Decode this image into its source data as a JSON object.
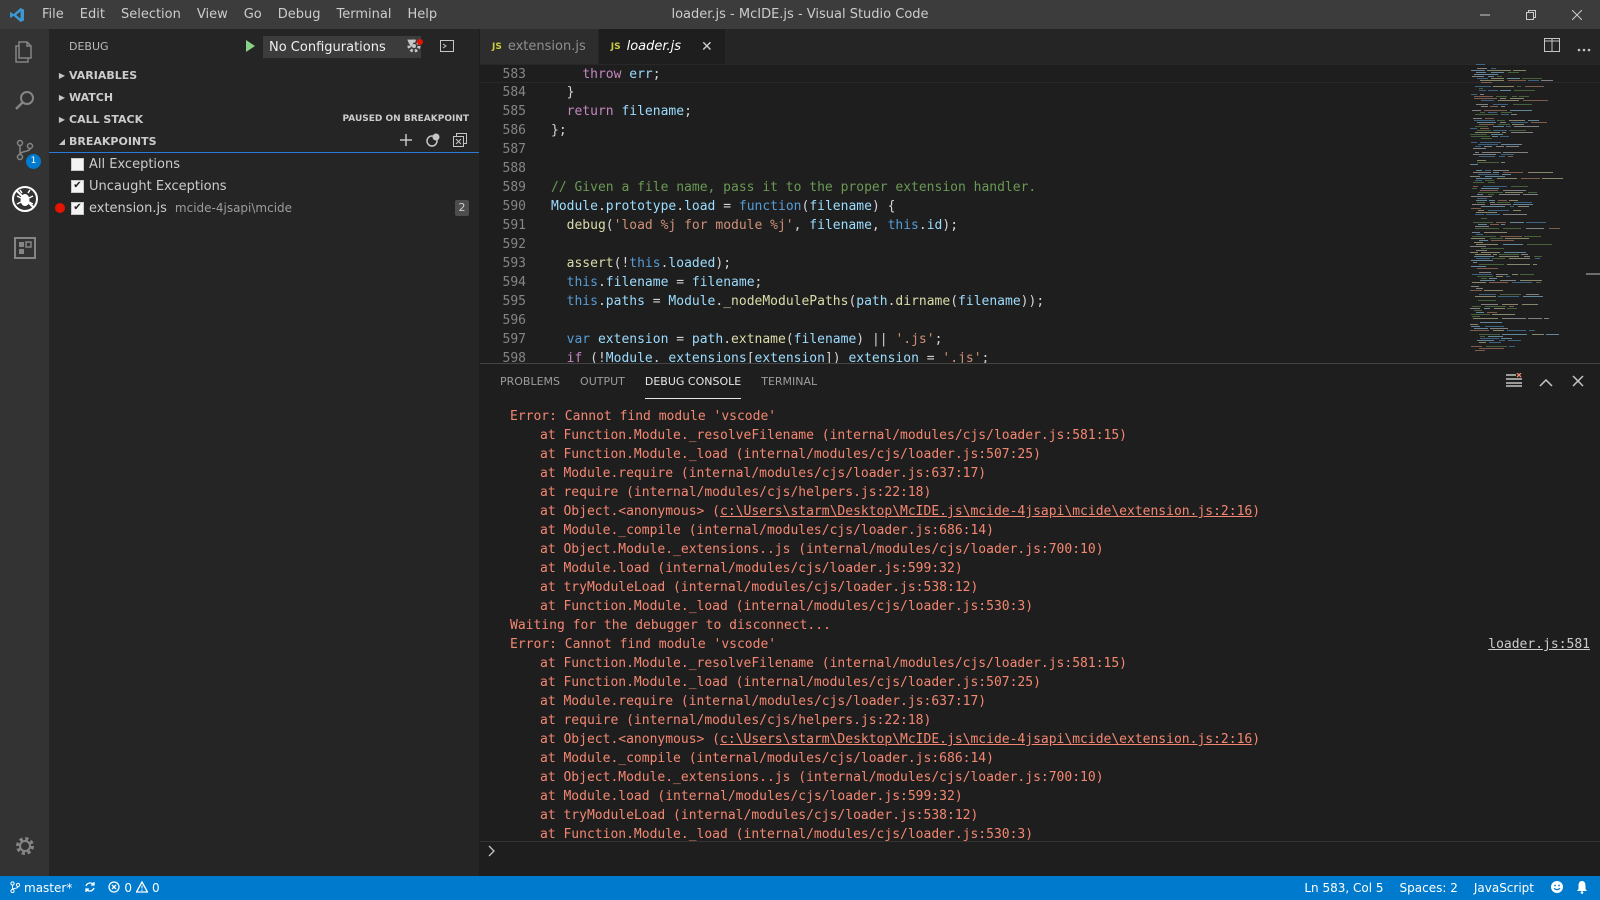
{
  "window": {
    "title": "loader.js - McIDE.js - Visual Studio Code",
    "menu": [
      "File",
      "Edit",
      "Selection",
      "View",
      "Go",
      "Debug",
      "Terminal",
      "Help"
    ]
  },
  "activity_bar": {
    "scm_badge": "1"
  },
  "sidebar": {
    "header": "DEBUG",
    "configuration": "No Configurations",
    "sections": {
      "variables": "VARIABLES",
      "watch": "WATCH",
      "call_stack": "CALL STACK",
      "call_stack_status": "PAUSED ON BREAKPOINT",
      "breakpoints": "BREAKPOINTS"
    },
    "breakpoints": [
      {
        "label": "All Exceptions",
        "checked": false
      },
      {
        "label": "Uncaught Exceptions",
        "checked": true
      },
      {
        "label": "extension.js",
        "path": "mcide-4jsapi\\mcide",
        "count": "2",
        "checked": true
      }
    ]
  },
  "tabs": [
    {
      "label": "extension.js",
      "icon": "JS"
    },
    {
      "label": "loader.js",
      "icon": "JS",
      "active": true
    }
  ],
  "code_lines": [
    {
      "n": "583",
      "c": "    throw err;"
    },
    {
      "n": "584",
      "c": "  }"
    },
    {
      "n": "585",
      "c": "  return filename;"
    },
    {
      "n": "586",
      "c": "};"
    },
    {
      "n": "587",
      "c": ""
    },
    {
      "n": "588",
      "c": ""
    },
    {
      "n": "589",
      "c": "// Given a file name, pass it to the proper extension handler."
    },
    {
      "n": "590",
      "c": "Module.prototype.load = function(filename) {"
    },
    {
      "n": "591",
      "c": "  debug('load %j for module %j', filename, this.id);"
    },
    {
      "n": "592",
      "c": ""
    },
    {
      "n": "593",
      "c": "  assert(!this.loaded);"
    },
    {
      "n": "594",
      "c": "  this.filename = filename;"
    },
    {
      "n": "595",
      "c": "  this.paths = Module._nodeModulePaths(path.dirname(filename));"
    },
    {
      "n": "596",
      "c": ""
    },
    {
      "n": "597",
      "c": "  var extension = path.extname(filename) || '.js';"
    },
    {
      "n": "598",
      "c": "  if (!Module._extensions[extension]) extension = '.js';"
    }
  ],
  "panel": {
    "tabs": [
      "PROBLEMS",
      "OUTPUT",
      "DEBUG CONSOLE",
      "TERMINAL"
    ],
    "console_lines": [
      {
        "t": "Error: Cannot find module 'vscode'",
        "ind": false
      },
      {
        "t": "at Function.Module._resolveFilename (internal/modules/cjs/loader.js:581:15)",
        "ind": true
      },
      {
        "t": "at Function.Module._load (internal/modules/cjs/loader.js:507:25)",
        "ind": true
      },
      {
        "t": "at Module.require (internal/modules/cjs/loader.js:637:17)",
        "ind": true
      },
      {
        "t": "at require (internal/modules/cjs/helpers.js:22:18)",
        "ind": true
      },
      {
        "t": "at Object.<anonymous> (",
        "link": "c:\\Users\\starm\\Desktop\\McIDE.js\\mcide-4jsapi\\mcide\\extension.js:2:16",
        "after": ")",
        "ind": true
      },
      {
        "t": "at Module._compile (internal/modules/cjs/loader.js:686:14)",
        "ind": true
      },
      {
        "t": "at Object.Module._extensions..js (internal/modules/cjs/loader.js:700:10)",
        "ind": true
      },
      {
        "t": "at Module.load (internal/modules/cjs/loader.js:599:32)",
        "ind": true
      },
      {
        "t": "at tryModuleLoad (internal/modules/cjs/loader.js:538:12)",
        "ind": true
      },
      {
        "t": "at Function.Module._load (internal/modules/cjs/loader.js:530:3)",
        "ind": true
      },
      {
        "t": "Waiting for the debugger to disconnect...",
        "ind": false
      },
      {
        "t": "Error: Cannot find module 'vscode'",
        "ind": false,
        "source": "loader.js:581"
      },
      {
        "t": "at Function.Module._resolveFilename (internal/modules/cjs/loader.js:581:15)",
        "ind": true
      },
      {
        "t": "at Function.Module._load (internal/modules/cjs/loader.js:507:25)",
        "ind": true
      },
      {
        "t": "at Module.require (internal/modules/cjs/loader.js:637:17)",
        "ind": true
      },
      {
        "t": "at require (internal/modules/cjs/helpers.js:22:18)",
        "ind": true
      },
      {
        "t": "at Object.<anonymous> (",
        "link": "c:\\Users\\starm\\Desktop\\McIDE.js\\mcide-4jsapi\\mcide\\extension.js:2:16",
        "after": ")",
        "ind": true
      },
      {
        "t": "at Module._compile (internal/modules/cjs/loader.js:686:14)",
        "ind": true
      },
      {
        "t": "at Object.Module._extensions..js (internal/modules/cjs/loader.js:700:10)",
        "ind": true
      },
      {
        "t": "at Module.load (internal/modules/cjs/loader.js:599:32)",
        "ind": true
      },
      {
        "t": "at tryModuleLoad (internal/modules/cjs/loader.js:538:12)",
        "ind": true
      },
      {
        "t": "at Function.Module._load (internal/modules/cjs/loader.js:530:3)",
        "ind": true
      }
    ]
  },
  "statusbar": {
    "branch": "master*",
    "errors": "0",
    "warnings": "0",
    "position": "Ln 583, Col 5",
    "spaces": "Spaces: 2",
    "language": "JavaScript"
  },
  "colors": {
    "accent": "#007acc",
    "breakpoint": "#e51400",
    "console_error": "#f48771"
  }
}
